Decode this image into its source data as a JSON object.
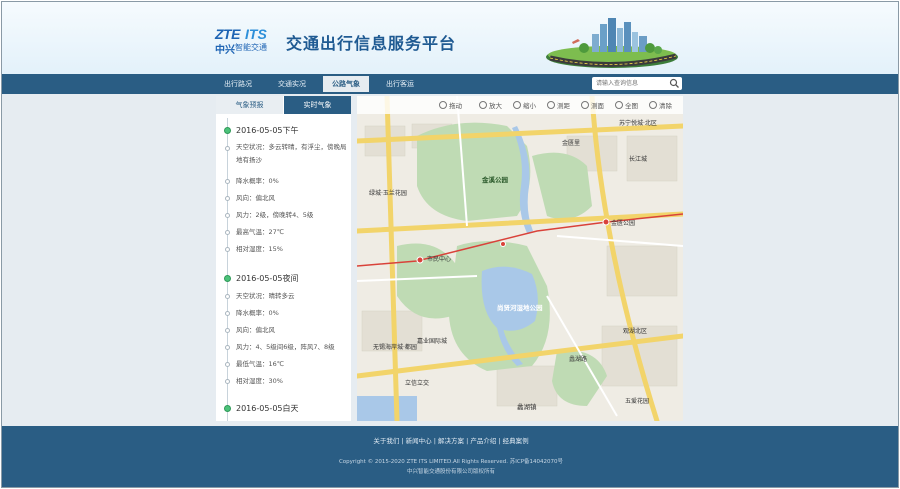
{
  "header": {
    "logo_zte": "ZTE",
    "logo_its": "ITS",
    "logo_cn": "中兴",
    "logo_cn_sub": "智能交通",
    "site_title": "交通出行信息服务平台"
  },
  "nav": {
    "items": [
      {
        "label": "出行路况",
        "active": false
      },
      {
        "label": "交通实况",
        "active": false
      },
      {
        "label": "公路气象",
        "active": true
      },
      {
        "label": "出行客运",
        "active": false
      }
    ],
    "search_placeholder": "请输入查询信息"
  },
  "weather_panel": {
    "tabs": [
      {
        "label": "气象预报",
        "active": false
      },
      {
        "label": "实时气象",
        "active": true
      }
    ],
    "days": [
      {
        "date": "2016-05-05下午",
        "lines": [
          "天空状况：多云转晴，有浮尘，傍晚局地有扬沙",
          "降水概率：0%",
          "风向：偏北风",
          "风力：2级，傍晚转4、5级",
          "最高气温：27℃",
          "相对湿度：15%"
        ]
      },
      {
        "date": "2016-05-05夜间",
        "lines": [
          "天空状况：晴转多云",
          "降水概率：0%",
          "风向：偏北风",
          "风力：4、5级间6级，阵风7、8级",
          "最低气温：16℃",
          "相对湿度：30%"
        ]
      },
      {
        "date": "2016-05-05白天",
        "lines": []
      }
    ]
  },
  "map": {
    "toolbar": [
      "拖动",
      "放大",
      "缩小",
      "测距",
      "测面",
      "全图",
      "清除"
    ],
    "labels": {
      "l1": "金溪公园",
      "l2": "绿城·玉兰花园",
      "l3": "市民中心",
      "l4": "尚贤河湿地公园",
      "l5": "嘉业国际城",
      "l6": "无锡海岸城·都园",
      "l7": "立信立交",
      "l8": "苏宁悦城·北区",
      "l9": "金匮里",
      "l10": "金匮公园",
      "l11": "观湖北区",
      "l12": "长江城",
      "l13": "蠡湖路",
      "l14": "五爱花园",
      "l15": "蠡湖镇"
    }
  },
  "footer": {
    "links": [
      "关于我们",
      "新闻中心",
      "解决方案",
      "产品介绍",
      "经典案例"
    ],
    "separator": " | ",
    "copyright": "Copyright © 2015-2020 ZTE ITS LIMITED.All Rights Reserved.   苏ICP备14042070号",
    "company": "中兴智能交通股份有限公司版权所有"
  },
  "colors": {
    "nav_bg": "#2a5d84",
    "title": "#1f5a92",
    "timeline_dot": "#4bc27a",
    "map_road_main": "#f2d46a",
    "map_water": "#a9c8e8",
    "map_green": "#bfdbb4",
    "metro_line": "#d9423a"
  }
}
